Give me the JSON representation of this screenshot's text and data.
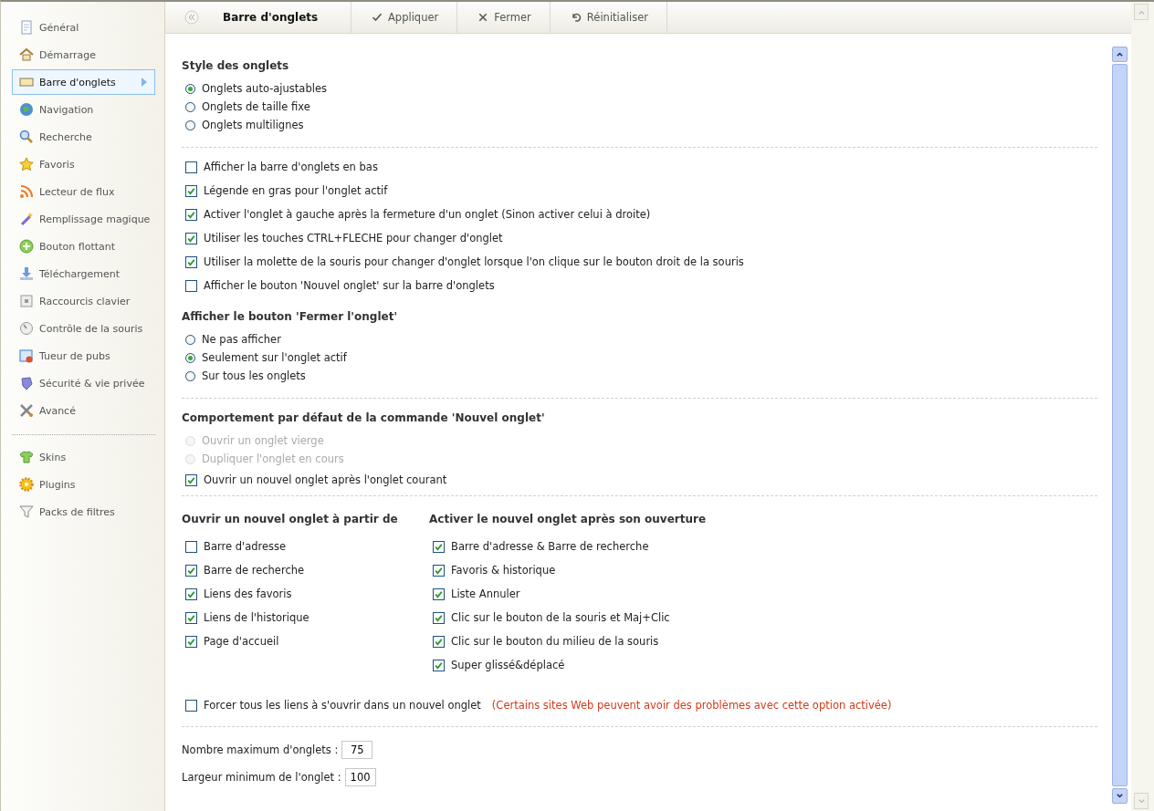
{
  "sidebar": {
    "groups": [
      [
        {
          "label": "Général",
          "selected": false
        },
        {
          "label": "Démarrage",
          "selected": false
        },
        {
          "label": "Barre d'onglets",
          "selected": true
        },
        {
          "label": "Navigation",
          "selected": false
        },
        {
          "label": "Recherche",
          "selected": false
        },
        {
          "label": "Favoris",
          "selected": false
        },
        {
          "label": "Lecteur de flux",
          "selected": false
        },
        {
          "label": "Remplissage magique",
          "selected": false
        },
        {
          "label": "Bouton flottant",
          "selected": false
        },
        {
          "label": "Téléchargement",
          "selected": false
        },
        {
          "label": "Raccourcis clavier",
          "selected": false
        },
        {
          "label": "Contrôle de la souris",
          "selected": false
        },
        {
          "label": "Tueur de pubs",
          "selected": false
        },
        {
          "label": "Sécurité & vie privée",
          "selected": false
        },
        {
          "label": "Avancé",
          "selected": false
        }
      ],
      [
        {
          "label": "Skins",
          "selected": false
        },
        {
          "label": "Plugins",
          "selected": false
        },
        {
          "label": "Packs de filtres",
          "selected": false
        }
      ]
    ]
  },
  "toolbar": {
    "title": "Barre d'onglets",
    "buttons": [
      "Appliquer",
      "Fermer",
      "Réinitialiser"
    ]
  },
  "sections": [
    {
      "kind": "list",
      "items": [
        {
          "kind": "heading",
          "label": "Style des onglets"
        },
        {
          "kind": "radio",
          "label": "Onglets auto-ajustables",
          "selected": true,
          "disabled": false
        },
        {
          "kind": "radio",
          "label": "Onglets de taille fixe",
          "selected": false,
          "disabled": false
        },
        {
          "kind": "radio",
          "label": "Onglets multilignes",
          "selected": false,
          "disabled": false
        }
      ]
    },
    {
      "kind": "list",
      "items": [
        {
          "kind": "checkbox",
          "label": "Afficher la barre d'onglets en bas",
          "checked": false
        },
        {
          "kind": "checkbox",
          "label": "Légende en gras pour l'onglet actif",
          "checked": true
        },
        {
          "kind": "checkbox",
          "label": "Activer l'onglet à gauche après la fermeture d'un onglet (Sinon activer celui à droite)",
          "checked": true
        },
        {
          "kind": "checkbox",
          "label": "Utiliser les touches CTRL+FLECHE pour changer d'onglet",
          "checked": true
        },
        {
          "kind": "checkbox",
          "label": "Utiliser la molette de la souris pour changer d'onglet lorsque l'on clique sur le bouton droit de la souris",
          "checked": true
        },
        {
          "kind": "checkbox",
          "label": "Afficher le bouton 'Nouvel onglet' sur la barre d'onglets",
          "checked": false
        },
        {
          "kind": "heading",
          "label": "Afficher le bouton 'Fermer l'onglet'"
        },
        {
          "kind": "radio",
          "label": "Ne pas afficher",
          "selected": false,
          "disabled": false
        },
        {
          "kind": "radio",
          "label": "Seulement sur l'onglet actif",
          "selected": true,
          "disabled": false
        },
        {
          "kind": "radio",
          "label": "Sur tous les onglets",
          "selected": false,
          "disabled": false
        }
      ]
    },
    {
      "kind": "list",
      "items": [
        {
          "kind": "heading",
          "label": "Comportement par défaut de la commande 'Nouvel onglet'"
        },
        {
          "kind": "radio",
          "label": "Ouvrir un onglet vierge",
          "selected": false,
          "disabled": true
        },
        {
          "kind": "radio",
          "label": "Dupliquer l'onglet en cours",
          "selected": false,
          "disabled": true
        },
        {
          "kind": "checkbox",
          "label": "Ouvrir un nouvel onglet après l'onglet courant",
          "checked": true
        }
      ]
    },
    {
      "kind": "columns",
      "columns": [
        {
          "heading": "Ouvrir un nouvel onglet à partir de",
          "items": [
            {
              "label": "Barre d'adresse",
              "checked": false
            },
            {
              "label": "Barre de recherche",
              "checked": true
            },
            {
              "label": "Liens des favoris",
              "checked": true
            },
            {
              "label": "Liens de l'historique",
              "checked": true
            },
            {
              "label": "Page d'accueil",
              "checked": true
            }
          ]
        },
        {
          "heading": "Activer le nouvel onglet après son ouverture",
          "items": [
            {
              "label": "Barre d'adresse & Barre de recherche",
              "checked": true
            },
            {
              "label": "Favoris & historique",
              "checked": true
            },
            {
              "label": "Liste Annuler",
              "checked": true
            },
            {
              "label": "Clic sur le bouton de la souris et Maj+Clic",
              "checked": true
            },
            {
              "label": "Clic sur le bouton du milieu de la souris",
              "checked": true
            },
            {
              "label": "Super glissé&déplacé",
              "checked": true
            }
          ]
        }
      ],
      "extra": {
        "label": "Forcer tous les liens à s'ouvrir dans un nouvel onglet",
        "checked": false,
        "warning": "(Certains sites Web peuvent avoir des problèmes avec cette option activée)"
      }
    },
    {
      "kind": "fields",
      "fields": [
        {
          "label": "Nombre maximum d'onglets :",
          "value": "75"
        },
        {
          "label": "Largeur minimum de l'onglet :",
          "value": "100"
        }
      ]
    }
  ]
}
